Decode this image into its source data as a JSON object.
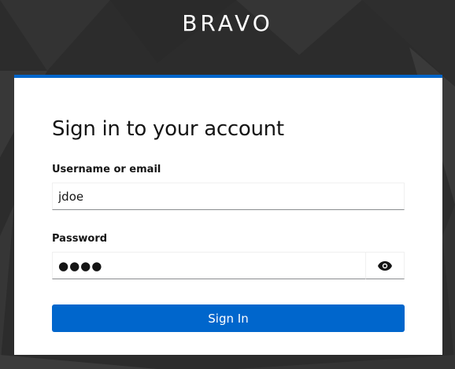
{
  "brand": {
    "name": "BRAVO"
  },
  "login": {
    "title": "Sign in to your account",
    "username_label": "Username or email",
    "username_value": "jdoe",
    "password_label": "Password",
    "password_value": "●●●●",
    "toggle_icon": "eye-icon",
    "submit_label": "Sign In"
  },
  "colors": {
    "accent": "#0066cc",
    "background": "#2f2f2f",
    "card": "#ffffff",
    "text": "#151515"
  }
}
